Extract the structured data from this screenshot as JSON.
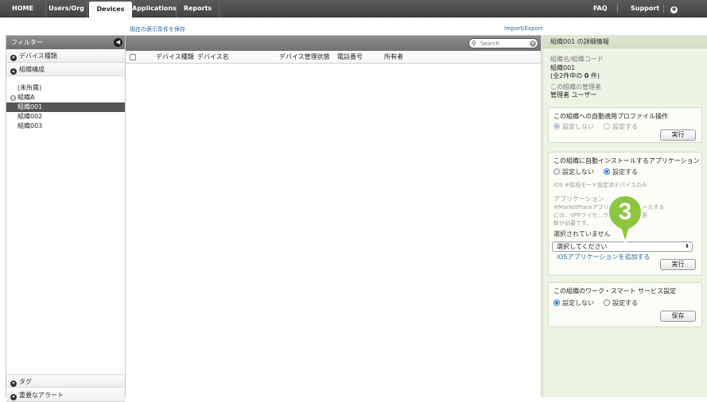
{
  "nav": {
    "tabs": [
      "HOME",
      "Users/Org",
      "Devices",
      "Applications",
      "Reports"
    ],
    "right": {
      "faq": "FAQ",
      "support": "Support",
      "settings": "Settings"
    }
  },
  "links": {
    "save_view": "現在の表示条件を保存",
    "import_export": "Import/Export"
  },
  "sidebar": {
    "filter_title": "フィルター",
    "device_type": "デバイス種類",
    "org_structure": "組織構成",
    "tree": [
      "(未所属)",
      "組織A",
      "組織001",
      "組織002",
      "組織003"
    ],
    "selected_index": 2,
    "tag": "タグ",
    "alert": "重要なアラート"
  },
  "table": {
    "search_placeholder": "Search",
    "columns": [
      "デバイス種類",
      "デバイス名",
      "デバイス管理状態",
      "電話番号",
      "所有者"
    ]
  },
  "details": {
    "title": "組織001 の詳細情報",
    "name_label": "組織名/組織コード",
    "name_value": "組織001",
    "count_prefix": "(全2件中の ",
    "count_number": "0",
    "count_suffix": " 件)",
    "admin_label": "この組織の管理者",
    "admin_value": "管理者 ユーザー",
    "profile_card": {
      "title": "この組織への自動適用プロファイル操作",
      "opt_off": "設定しない",
      "opt_on": "設定する",
      "button": "実行"
    },
    "app_card": {
      "title": "この組織に自動インストールするアプリケーション",
      "opt_off": "設定しない",
      "opt_on": "設定する",
      "ios_note": "iOS ※監視モード設定済デバイスのみ",
      "app_label": "アプリケーション",
      "note_line1": "※MarketPlaceアプリ…動インストールする",
      "note_line2": "には、VPPライセ…ライセンス数の更",
      "note_line3": "新が必要です。",
      "none_selected": "選択されていません",
      "select_value": "選択してください",
      "add_link": "iOSアプリケーションを追加する",
      "button": "実行"
    },
    "work_card": {
      "title": "この組織のワーク・スマート サービス設定",
      "opt_off": "設定しない",
      "opt_on": "設定する",
      "button": "保存"
    }
  },
  "callout": {
    "number": "3",
    "color": "#8cc63f"
  }
}
